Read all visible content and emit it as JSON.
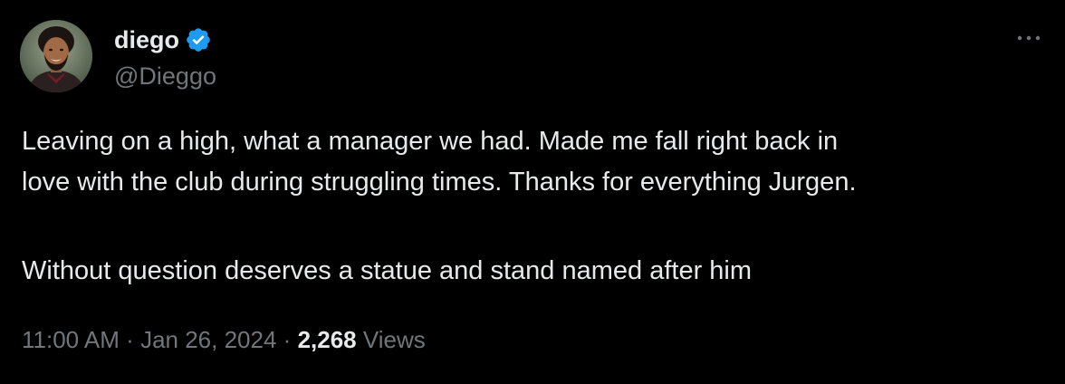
{
  "tweet": {
    "author": {
      "name": "diego",
      "handle": "@Dieggo",
      "verified": true
    },
    "lines": [
      "Leaving on a high, what a manager we had. Made me fall right back in",
      "love with the club during struggling times. Thanks for everything Jurgen.",
      "Without question deserves a statue and stand named after him"
    ],
    "time": "11:00 AM",
    "separator": "·",
    "date": "Jan 26, 2024",
    "views_count": "2,268",
    "views_label": "Views"
  },
  "colors": {
    "background": "#000000",
    "primary_text": "#e7e9ea",
    "secondary_text": "#71767b",
    "verified_badge": "#1d9bf0"
  },
  "icons": {
    "verified": "verified-badge-icon",
    "more": "more-options-icon"
  }
}
